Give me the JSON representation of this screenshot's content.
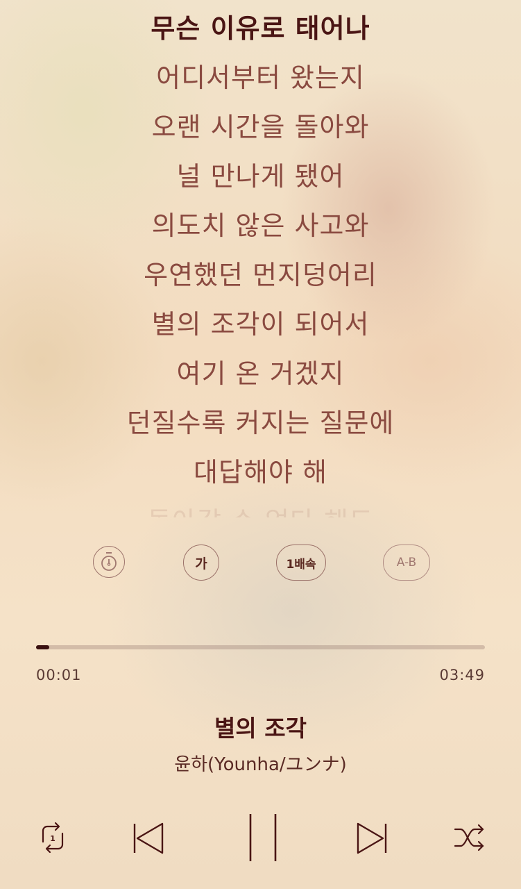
{
  "lyrics": [
    "무슨 이유로 태어나",
    "어디서부터 왔는지",
    "오랜 시간을 돌아와",
    "널 만나게 됐어",
    "의도치 않은 사고와",
    "우연했던 먼지덩어리",
    "별의 조각이 되어서",
    "여기 온 거겠지",
    "던질수록 커지는 질문에",
    "대답해야 해",
    "돌아갈 수 없다 해도"
  ],
  "tools": {
    "timer_icon": "timer-icon",
    "font_label": "가",
    "speed_label": "1배속",
    "ab_label": "A-B"
  },
  "progress": {
    "current": "00:01",
    "total": "03:49",
    "fraction": 0.004
  },
  "song": {
    "title": "별의 조각",
    "artist": "윤하(Younha/ユンナ)"
  },
  "controls": {
    "repeat_icon": "repeat-one-icon",
    "repeat_badge": "1",
    "prev_icon": "skip-previous-icon",
    "pause_icon": "pause-icon",
    "next_icon": "skip-next-icon",
    "shuffle_icon": "shuffle-icon"
  },
  "colors": {
    "accent_dark": "#4a1514",
    "lyric_text": "#8a4a40"
  }
}
